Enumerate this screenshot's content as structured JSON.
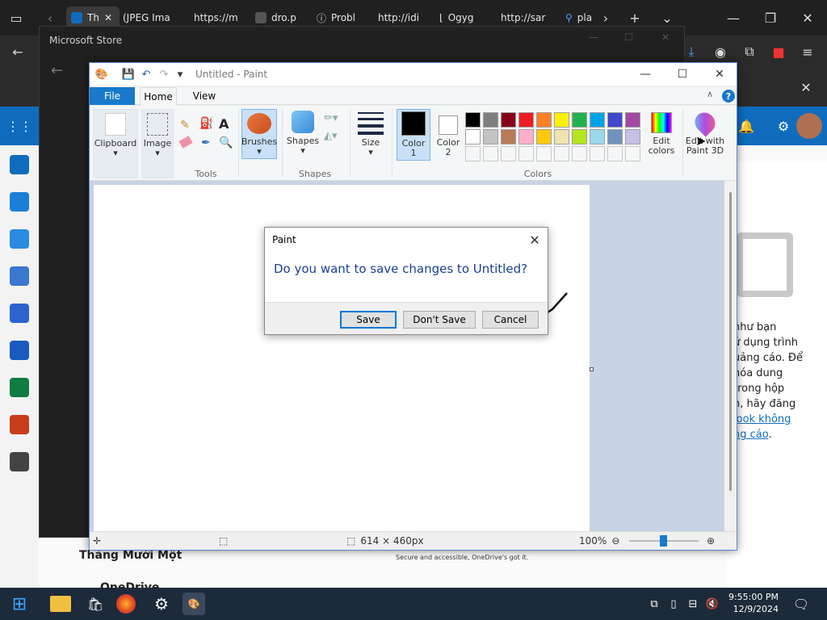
{
  "browser": {
    "tabs": [
      "Th",
      "(JPEG Ima",
      "https://m",
      "dro.p",
      "Probl",
      "http://idi",
      "Ogyg",
      "http://sar",
      "pla"
    ]
  },
  "store": {
    "title": "Microsoft Store"
  },
  "paint": {
    "title": "Untitled - Paint",
    "tabs": {
      "file": "File",
      "home": "Home",
      "view": "View"
    },
    "ribbon": {
      "clipboard": "Clipboard",
      "image": "Image",
      "tools_group": "Tools",
      "brushes": "Brushes",
      "shapes": "Shapes",
      "shapes_group": "Shapes",
      "size": "Size",
      "color1_line1": "Color",
      "color1_line2": "1",
      "color2_line1": "Color",
      "color2_line2": "2",
      "colors_group": "Colors",
      "edit_colors_line1": "Edit",
      "edit_colors_line2": "colors",
      "paint3d_line1": "Edit with",
      "paint3d_line2": "Paint 3D"
    },
    "palette_row1": [
      "#000000",
      "#7f7f7f",
      "#880015",
      "#ed1c24",
      "#ff7f27",
      "#fff200",
      "#22b14c",
      "#00a2e8",
      "#3f48cc",
      "#a349a4"
    ],
    "palette_row2": [
      "#ffffff",
      "#c3c3c3",
      "#b97a57",
      "#ffaec9",
      "#ffc90e",
      "#efe4b0",
      "#b5e61d",
      "#99d9ea",
      "#7092be",
      "#c8bfe7"
    ],
    "status": {
      "dimensions": "614 × 460px",
      "zoom": "100%"
    }
  },
  "dialog": {
    "title": "Paint",
    "message": "Do you want to save changes to Untitled?",
    "save": "Save",
    "dont_save": "Don't Save",
    "cancel": "Cancel"
  },
  "outlook": {
    "folder": "Tháng Mười Một",
    "item": "OneDrive",
    "ad_text": "Secure and accessible, OneDrive's got it.",
    "side_lines": [
      "như bạn",
      "ử dụng trình",
      "uảng cáo. Để",
      "hóa dung",
      "trong hộp",
      "n, hãy đăng"
    ],
    "side_link_1": "look không",
    "side_link_2": "ng cáo"
  },
  "taskbar": {
    "time": "9:55:00 PM",
    "date": "12/9/2024"
  }
}
